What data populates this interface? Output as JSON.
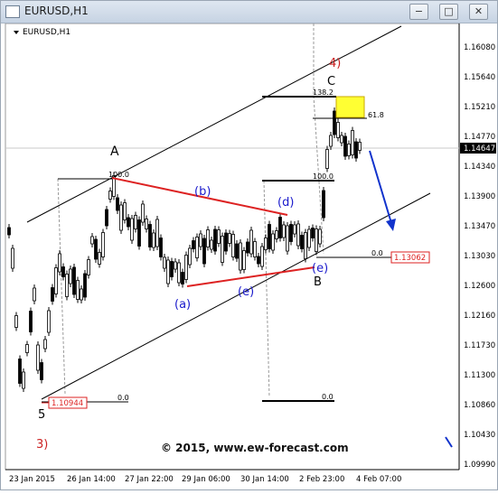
{
  "window": {
    "title": "EURUSD,H1",
    "controls": [
      "−",
      "□",
      "✕"
    ]
  },
  "chart": {
    "symbol_label": "EURUSD,H1",
    "watermark": "© 2015, www.ew-forecast.com",
    "current_price": "1.14647",
    "price_ticks": [
      "1.16080",
      "1.15640",
      "1.15210",
      "1.14770",
      "1.14340",
      "1.13900",
      "1.13470",
      "1.13030",
      "1.12600",
      "1.12160",
      "1.11730",
      "1.11300",
      "1.10860",
      "1.10430",
      "1.09990"
    ],
    "time_ticks": [
      "23 Jan 2015",
      "26 Jan 14:00",
      "27 Jan 22:00",
      "29 Jan 06:00",
      "30 Jan 14:00",
      "2 Feb 23:00",
      "4 Feb 07:00"
    ],
    "wave_labels": {
      "w4": "4)",
      "C": "C",
      "A": "A",
      "b": "(b)",
      "d": "(d)",
      "a": "(a)",
      "e1": "(e)",
      "e2": "(e)",
      "B": "B",
      "five": "5",
      "w3": "3)"
    },
    "level_labels": {
      "ratio_138": "138.2",
      "ratio_618": "61.8",
      "ratio_100a": "100.0",
      "ratio_100b": "100.0",
      "zero_a": "0.0",
      "zero_b": "0.0",
      "zero_c": "0.0"
    },
    "price_boxes": {
      "low": "1.10944",
      "support": "1.13062"
    },
    "colors": {
      "candles": "#000000",
      "channel": "#000000",
      "triangle": "#dd2222",
      "wave_blue": "#1a1acc",
      "wave_red": "#cc2222",
      "target_box": "#ffff33",
      "forecast_arrow": "#1133cc",
      "price_box": "#dd2222"
    }
  }
}
